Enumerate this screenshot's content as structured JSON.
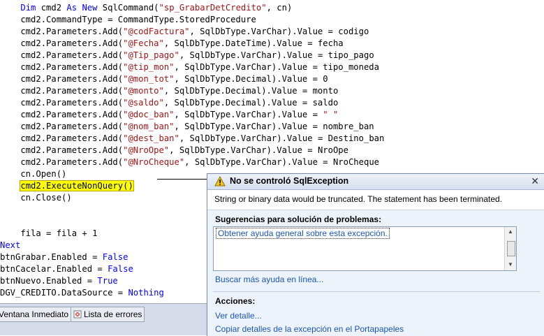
{
  "code": {
    "lines": [
      [
        {
          "t": "    "
        },
        {
          "t": "Dim",
          "c": "kw"
        },
        {
          "t": " cmd2 "
        },
        {
          "t": "As",
          "c": "kw"
        },
        {
          "t": " "
        },
        {
          "t": "New",
          "c": "kw"
        },
        {
          "t": " SqlCommand("
        },
        {
          "t": "\"sp_GrabarDetCredito\"",
          "c": "str"
        },
        {
          "t": ", cn)"
        }
      ],
      [
        {
          "t": "    cmd2.CommandType = CommandType.StoredProcedure"
        }
      ],
      [
        {
          "t": "    cmd2.Parameters.Add("
        },
        {
          "t": "\"@codFactura\"",
          "c": "str"
        },
        {
          "t": ", SqlDbType.VarChar).Value = codigo"
        }
      ],
      [
        {
          "t": "    cmd2.Parameters.Add("
        },
        {
          "t": "\"@Fecha\"",
          "c": "str"
        },
        {
          "t": ", SqlDbType.DateTime).Value = fecha"
        }
      ],
      [
        {
          "t": "    cmd2.Parameters.Add("
        },
        {
          "t": "\"@Tip_pago\"",
          "c": "str"
        },
        {
          "t": ", SqlDbType.VarChar).Value = tipo_pago"
        }
      ],
      [
        {
          "t": "    cmd2.Parameters.Add("
        },
        {
          "t": "\"@tip_mon\"",
          "c": "str"
        },
        {
          "t": ", SqlDbType.VarChar).Value = tipo_moneda"
        }
      ],
      [
        {
          "t": "    cmd2.Parameters.Add("
        },
        {
          "t": "\"@mon_tot\"",
          "c": "str"
        },
        {
          "t": ", SqlDbType.Decimal).Value = 0"
        }
      ],
      [
        {
          "t": "    cmd2.Parameters.Add("
        },
        {
          "t": "\"@monto\"",
          "c": "str"
        },
        {
          "t": ", SqlDbType.Decimal).Value = monto"
        }
      ],
      [
        {
          "t": "    cmd2.Parameters.Add("
        },
        {
          "t": "\"@saldo\"",
          "c": "str"
        },
        {
          "t": ", SqlDbType.Decimal).Value = saldo"
        }
      ],
      [
        {
          "t": "    cmd2.Parameters.Add("
        },
        {
          "t": "\"@doc_ban\"",
          "c": "str"
        },
        {
          "t": ", SqlDbType.VarChar).Value = "
        },
        {
          "t": "\" \"",
          "c": "str"
        }
      ],
      [
        {
          "t": "    cmd2.Parameters.Add("
        },
        {
          "t": "\"@nom_ban\"",
          "c": "str"
        },
        {
          "t": ", SqlDbType.VarChar).Value = nombre_ban"
        }
      ],
      [
        {
          "t": "    cmd2.Parameters.Add("
        },
        {
          "t": "\"@dest_ban\"",
          "c": "str"
        },
        {
          "t": ", SqlDbType.VarChar).Value = Destino_ban"
        }
      ],
      [
        {
          "t": "    cmd2.Parameters.Add("
        },
        {
          "t": "\"@NroOpe\"",
          "c": "str"
        },
        {
          "t": ", SqlDbType.VarChar).Value = NroOpe"
        }
      ],
      [
        {
          "t": "    cmd2.Parameters.Add("
        },
        {
          "t": "\"@NroCheque\"",
          "c": "str"
        },
        {
          "t": ", SqlDbType.VarChar).Value = NroCheque"
        }
      ],
      [
        {
          "t": "    cn.Open()"
        }
      ],
      [
        {
          "t": "    "
        },
        {
          "t": "cmd2.ExecuteNonQuery()",
          "c": "hl"
        }
      ],
      [
        {
          "t": "    cn.Close()"
        }
      ],
      [
        {
          "t": ""
        }
      ],
      [
        {
          "t": ""
        }
      ],
      [
        {
          "t": "    fila = fila + 1"
        }
      ],
      [
        {
          "t": "Next",
          "c": "kw"
        }
      ],
      [
        {
          "t": "btnGrabar.Enabled = "
        },
        {
          "t": "False",
          "c": "kw"
        }
      ],
      [
        {
          "t": "btnCacelar.Enabled = "
        },
        {
          "t": "False",
          "c": "kw"
        }
      ],
      [
        {
          "t": "btnNuevo.Enabled = "
        },
        {
          "t": "True",
          "c": "kw"
        }
      ],
      [
        {
          "t": "DGV_CREDITO.DataSource = "
        },
        {
          "t": "Nothing",
          "c": "kw"
        }
      ]
    ]
  },
  "tabs": {
    "immediate_label": "Ventana Inmediato",
    "errors_label": "Lista de errores"
  },
  "exception": {
    "title": "No se controló SqlException",
    "message": "String or binary data would be truncated. The statement has been terminated.",
    "suggestions_title": "Sugerencias para solución de problemas:",
    "suggestion_item": "Obtener ayuda general sobre esta excepción.",
    "more_help_link": "Buscar más ayuda en línea...",
    "actions_title": "Acciones:",
    "view_detail_link": "Ver detalle...",
    "copy_detail_link": "Copiar detalles de la excepción en el Portapapeles"
  },
  "colors": {
    "keyword": "#0000ff",
    "string": "#a31515",
    "highlight": "#ffff00",
    "link": "#1a56b8"
  }
}
